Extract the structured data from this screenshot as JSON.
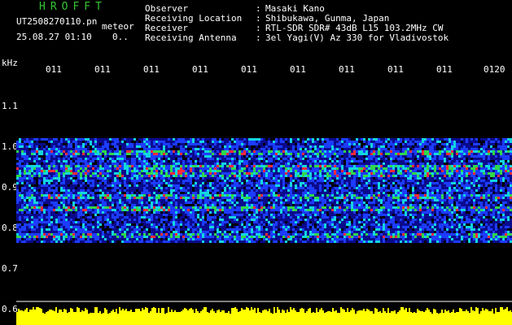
{
  "header": {
    "app_title": "HROFFT",
    "file_name": "UT2508270110.pn",
    "mode_label": "meteor",
    "date_time": "25.08.27 01:10",
    "count_label": "0..",
    "info": [
      {
        "label": "Observer",
        "value": "Masaki Kano"
      },
      {
        "label": "Receiving Location",
        "value": "Shibukawa, Gunma, Japan"
      },
      {
        "label": "Receiver",
        "value": "RTL-SDR SDR# 43dB L15 103.2MHz CW"
      },
      {
        "label": "Receiving Antenna",
        "value": "3el Yagi(V) Az 330 for Vladivostok"
      }
    ],
    "separator": ":"
  },
  "axis": {
    "unit": "kHz",
    "y_ticks": [
      "1.1",
      "1.0",
      "0.9",
      "0.8",
      "0.7",
      "0.6"
    ],
    "x_ticks": [
      "011",
      "011",
      "011",
      "011",
      "011",
      "011",
      "011",
      "011",
      "011",
      "0120"
    ]
  },
  "colors": {
    "title": "#34c534",
    "text": "#ffffff",
    "tick_label": "#ffff33",
    "background": "#000000",
    "band_dark": "#0a0a8c",
    "band_mid": "#1c3cff",
    "band_cyan": "#12d6e0",
    "band_green": "#2fd84a",
    "band_red": "#ff2a3a",
    "noise_bar": "#ffff00"
  }
}
